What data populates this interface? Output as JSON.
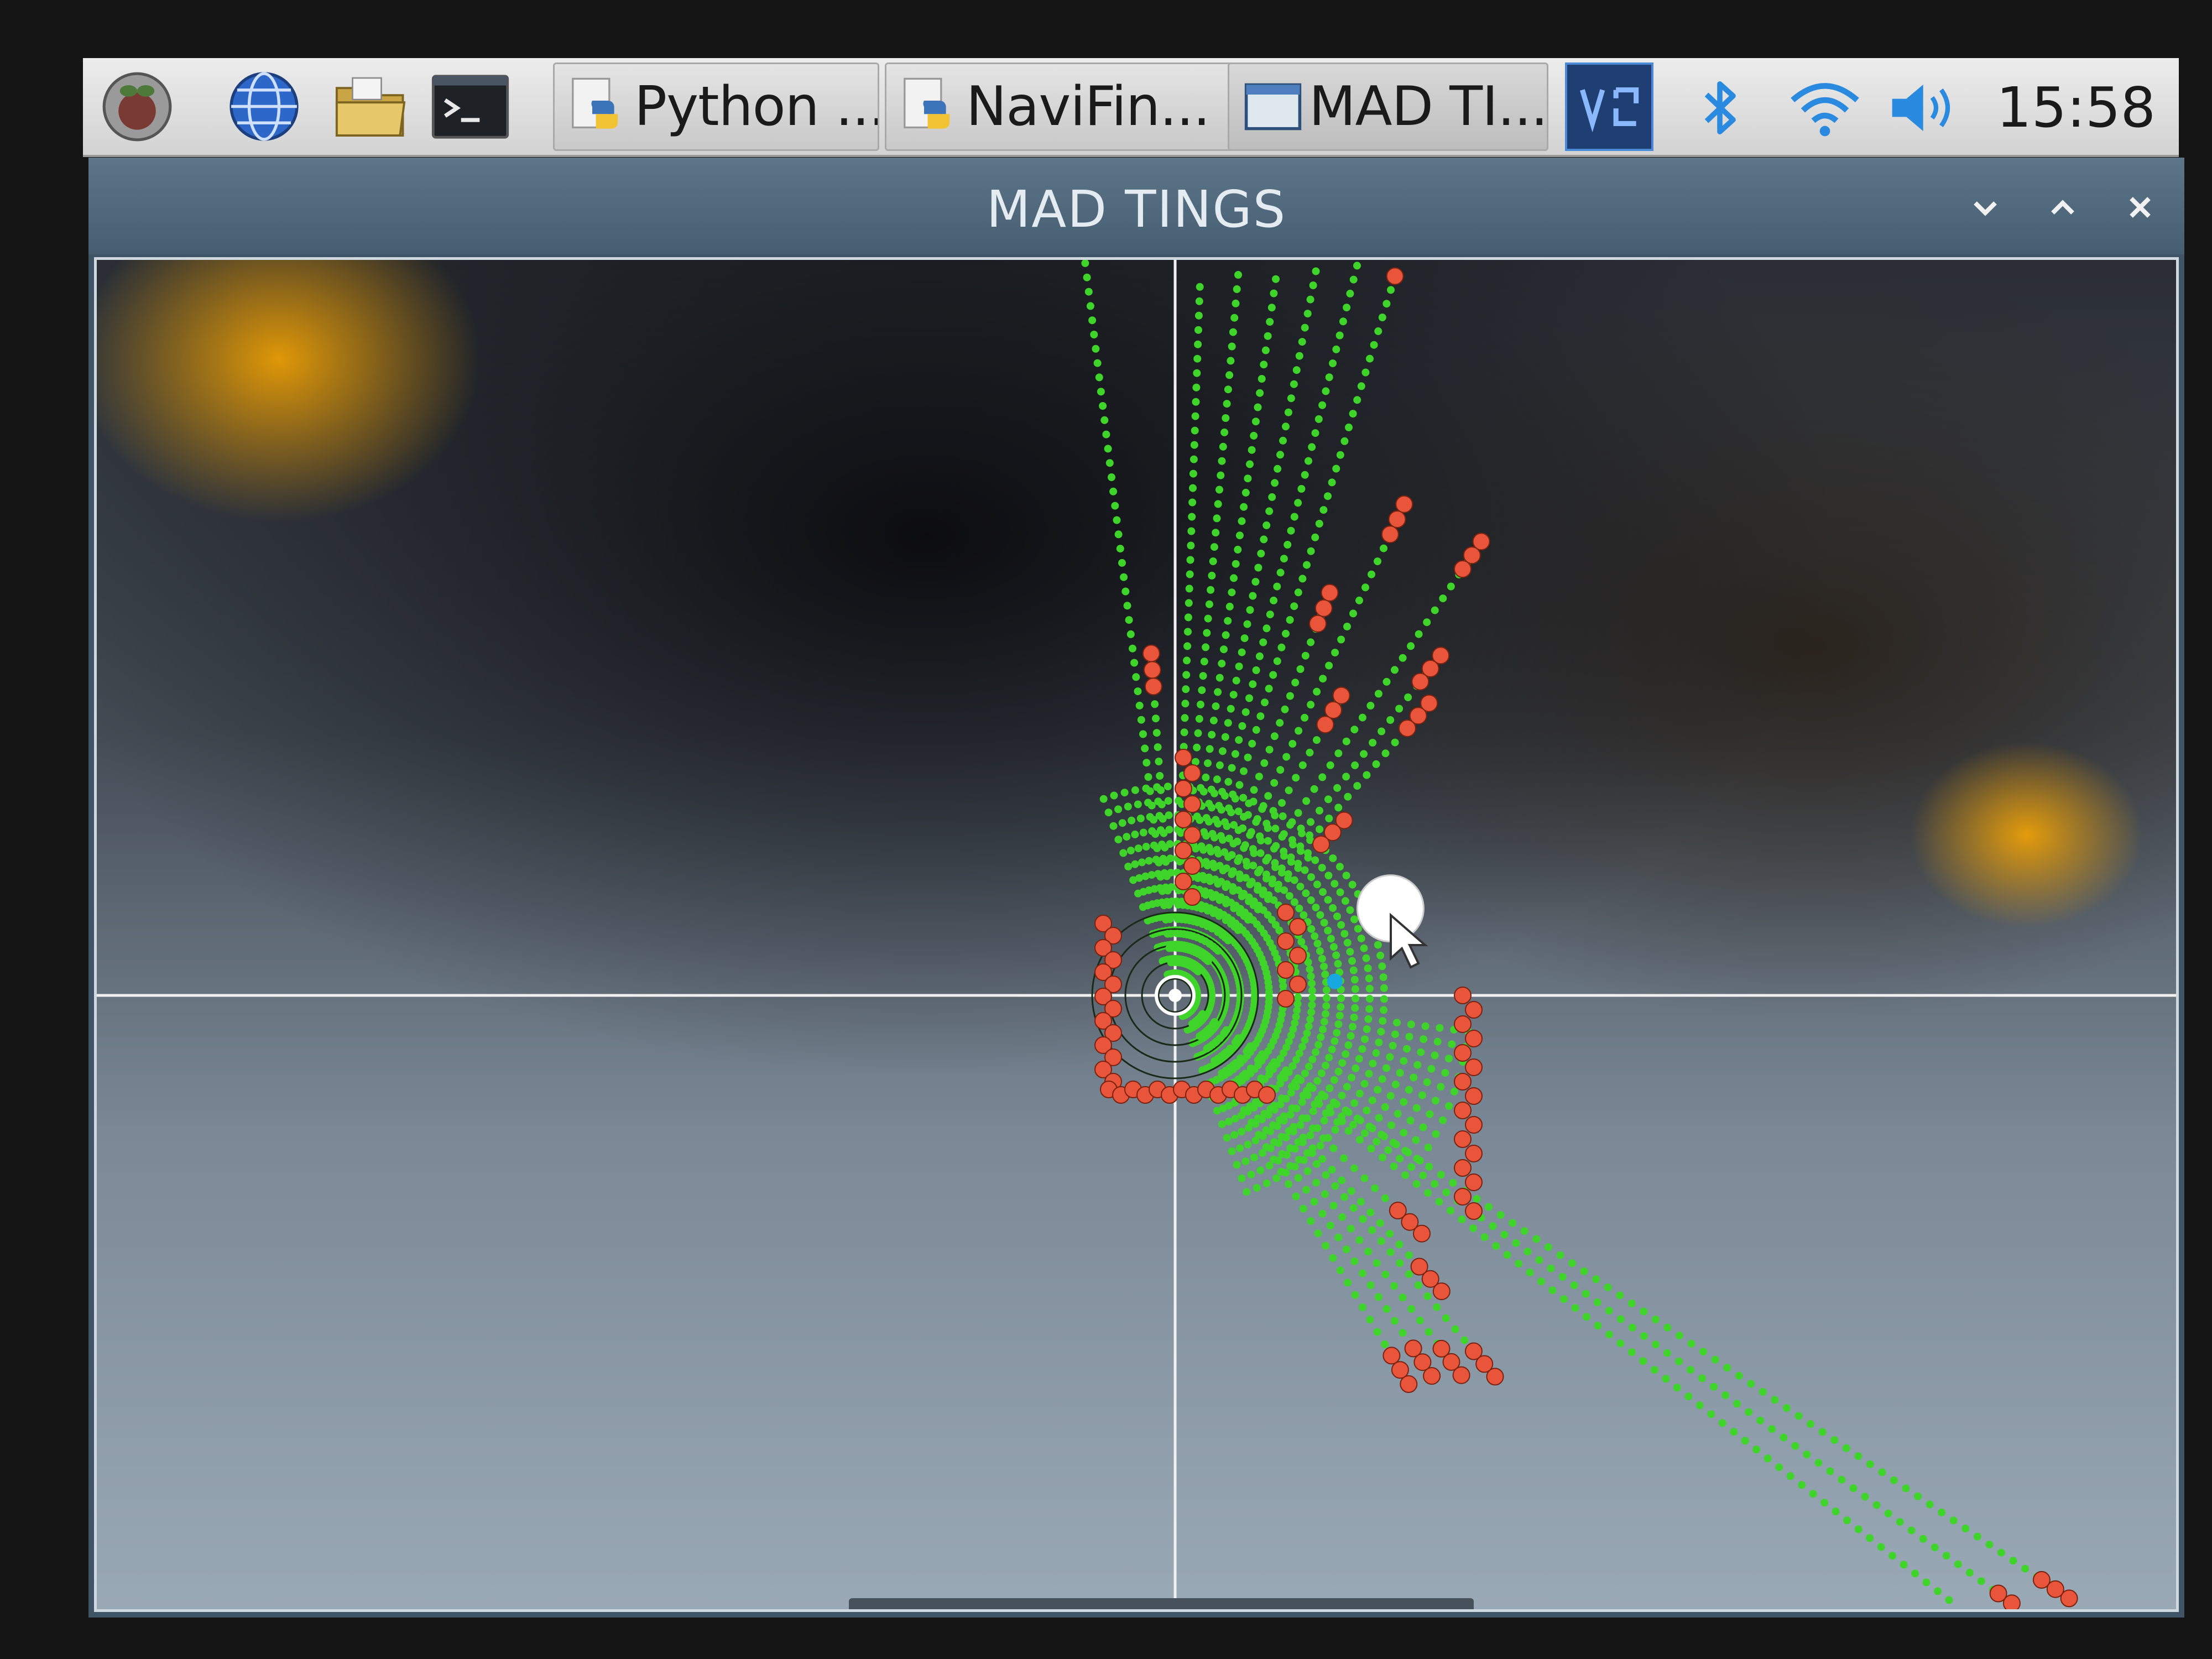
{
  "taskbar": {
    "launchers": [
      {
        "name": "raspberry-menu-icon"
      },
      {
        "name": "web-browser-icon"
      },
      {
        "name": "file-manager-icon"
      },
      {
        "name": "terminal-icon"
      }
    ],
    "tasks": [
      {
        "label": "Python ...",
        "icon": "python-icon"
      },
      {
        "label": "NaviFin...",
        "icon": "python-icon"
      },
      {
        "label": "MAD TI...",
        "icon": "window-icon"
      }
    ],
    "tray": {
      "vnc_icon": "vnc-icon",
      "bluetooth_icon": "bluetooth-icon",
      "wifi_icon": "wifi-icon",
      "volume_icon": "volume-icon",
      "clock": "15:58"
    }
  },
  "window": {
    "title": "MAD TINGS",
    "controls": [
      "minimize-icon",
      "maximize-icon",
      "close-icon"
    ]
  },
  "plot": {
    "colors": {
      "free_ray": "#3fd42a",
      "obstacle": "#e8553a",
      "origin": "#ffffff",
      "target": "#ffffff",
      "heading_marker": "#18a8e0",
      "axes": "#f0f0f0",
      "cursor": "#ffffff"
    },
    "target": {
      "bearing_deg": 68,
      "range": 0.42
    },
    "heading_marker": {
      "bearing_deg": 85,
      "range": 0.29
    },
    "rays_upper": [
      {
        "bearing_deg": -7,
        "range": 1.34,
        "hit": false
      },
      {
        "bearing_deg": -4,
        "range": 0.62,
        "hit": true
      },
      {
        "bearing_deg": 2,
        "range": 1.3,
        "hit": false
      },
      {
        "bearing_deg": 5,
        "range": 1.31,
        "hit": false
      },
      {
        "bearing_deg": 8,
        "range": 1.32,
        "hit": false
      },
      {
        "bearing_deg": 11,
        "range": 1.34,
        "hit": false
      },
      {
        "bearing_deg": 14,
        "range": 1.37,
        "hit": false
      },
      {
        "bearing_deg": 17,
        "range": 1.42,
        "hit": true
      },
      {
        "bearing_deg": 21,
        "range": 0.78,
        "hit": true
      },
      {
        "bearing_deg": 25,
        "range": 0.98,
        "hit": true
      },
      {
        "bearing_deg": 29,
        "range": 0.62,
        "hit": true
      },
      {
        "bearing_deg": 34,
        "range": 0.99,
        "hit": true
      },
      {
        "bearing_deg": 38,
        "range": 0.78,
        "hit": true
      },
      {
        "bearing_deg": 41,
        "range": 0.7,
        "hit": true
      },
      {
        "bearing_deg": 44,
        "range": 0.44,
        "hit": true
      }
    ],
    "rays_lower": [
      {
        "bearing_deg": 140,
        "range": 0.9,
        "hit": true
      },
      {
        "bearing_deg": 143,
        "range": 0.86,
        "hit": true
      },
      {
        "bearing_deg": 146,
        "range": 0.83,
        "hit": true
      },
      {
        "bearing_deg": 149,
        "range": 0.82,
        "hit": true
      },
      {
        "bearing_deg": 134,
        "range": 0.62,
        "hit": true
      },
      {
        "bearing_deg": 138,
        "range": 0.72,
        "hit": true
      },
      {
        "bearing_deg": 124,
        "range": 1.95,
        "hit": true
      },
      {
        "bearing_deg": 126,
        "range": 1.9,
        "hit": true
      },
      {
        "bearing_deg": 128,
        "range": 1.86,
        "hit": false
      }
    ]
  }
}
